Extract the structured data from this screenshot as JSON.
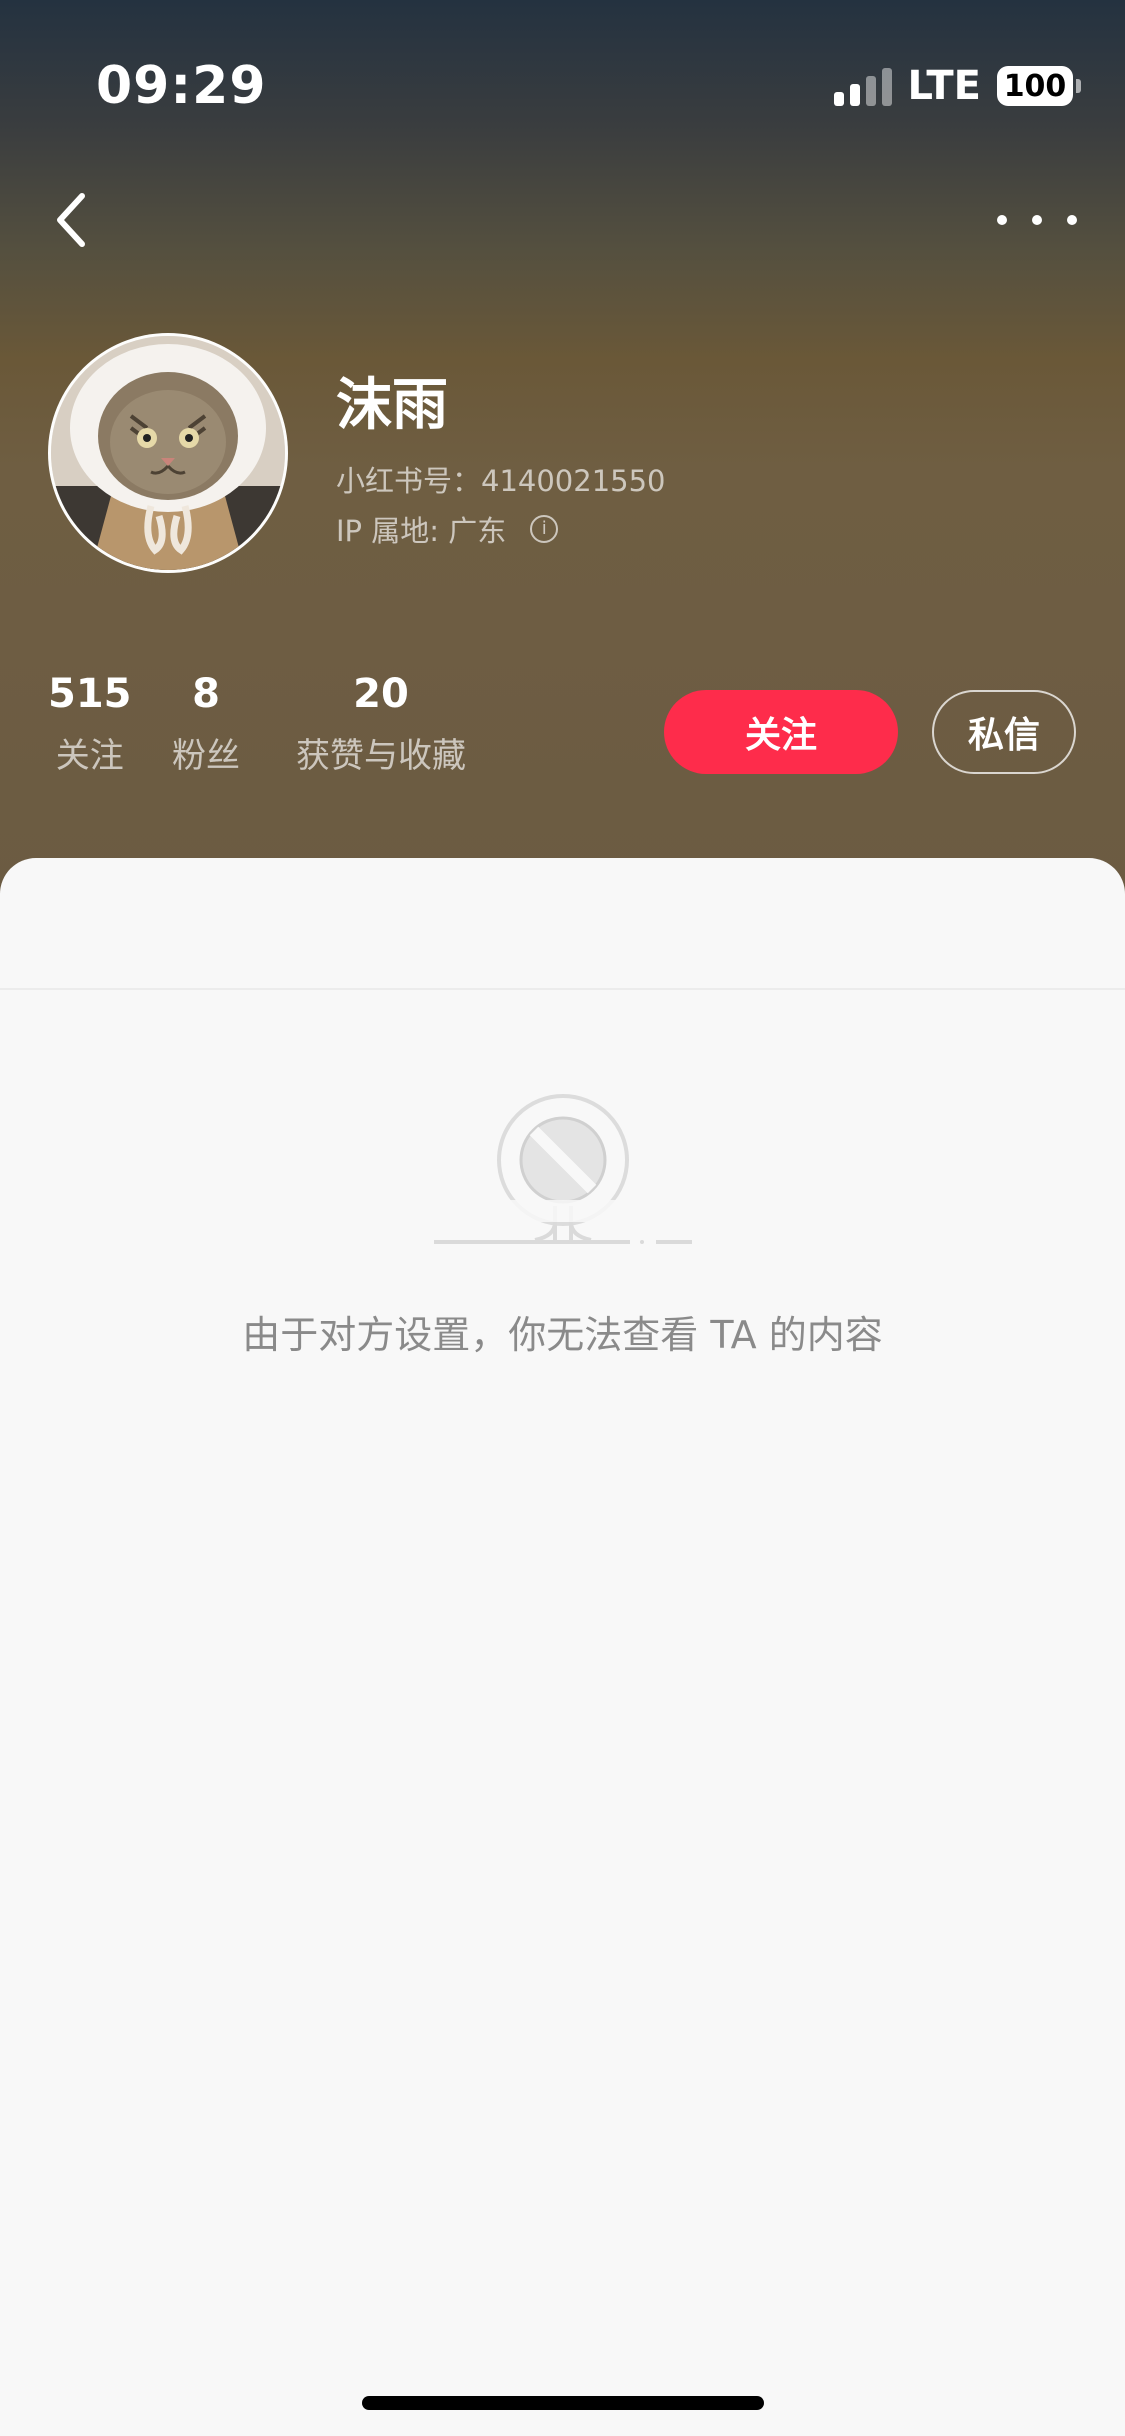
{
  "status_bar": {
    "time": "09:29",
    "network": "LTE",
    "battery": "100",
    "icons": [
      "signal-icon",
      "battery-icon"
    ]
  },
  "nav": {
    "back_icon": "chevron-left-icon",
    "more_icon": "more-horizontal-icon"
  },
  "profile": {
    "avatar": "cat-avatar",
    "username": "沫雨",
    "user_id": "小红书号：4140021550",
    "ip_location": "IP 属地: 广东",
    "info_icon": "info-icon"
  },
  "stats": [
    {
      "value": "515",
      "label": "关注"
    },
    {
      "value": "8",
      "label": "粉丝"
    },
    {
      "value": "20",
      "label": "获赞与收藏"
    }
  ],
  "actions": {
    "follow_label": "关注",
    "message_label": "私信"
  },
  "content": {
    "empty_icon": "restricted-icon",
    "empty_message": "由于对方设置，你无法查看 TA 的内容"
  },
  "colors": {
    "follow_button": "#fe2c4b",
    "page_background": "#f8f8f8",
    "empty_text": "#8a8a8a"
  }
}
